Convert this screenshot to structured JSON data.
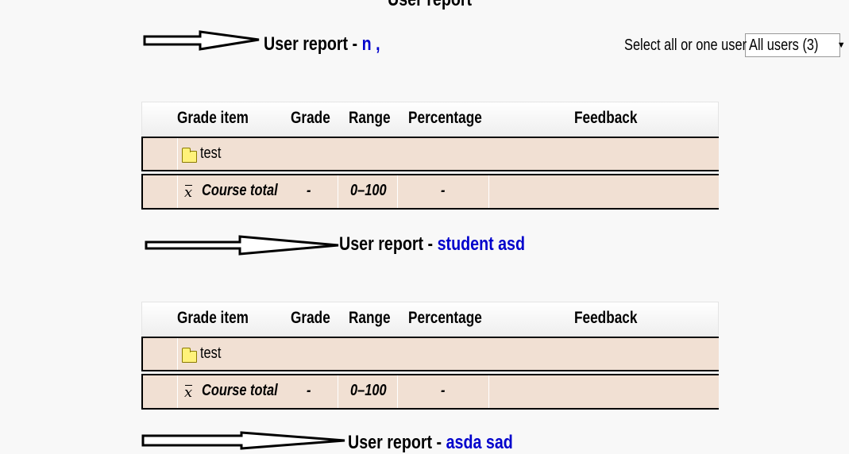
{
  "page": {
    "title": "User report"
  },
  "select": {
    "label": "Select all or one user",
    "value": "All users (3)"
  },
  "reports": [
    {
      "label": "User report - ",
      "name": "n ,"
    },
    {
      "label": "User report - ",
      "name": "student asd"
    },
    {
      "label": "User report - ",
      "name": "asda sad"
    }
  ],
  "table": {
    "headers": [
      "Grade item",
      "Grade",
      "Range",
      "Percentage",
      "Feedback"
    ],
    "category_name": "test",
    "total": {
      "label": "Course total",
      "grade": "-",
      "range": "0–100",
      "percentage": "-"
    }
  },
  "colors": {
    "row_bg": "#f1e0d3",
    "name_link": "#0000cc"
  }
}
